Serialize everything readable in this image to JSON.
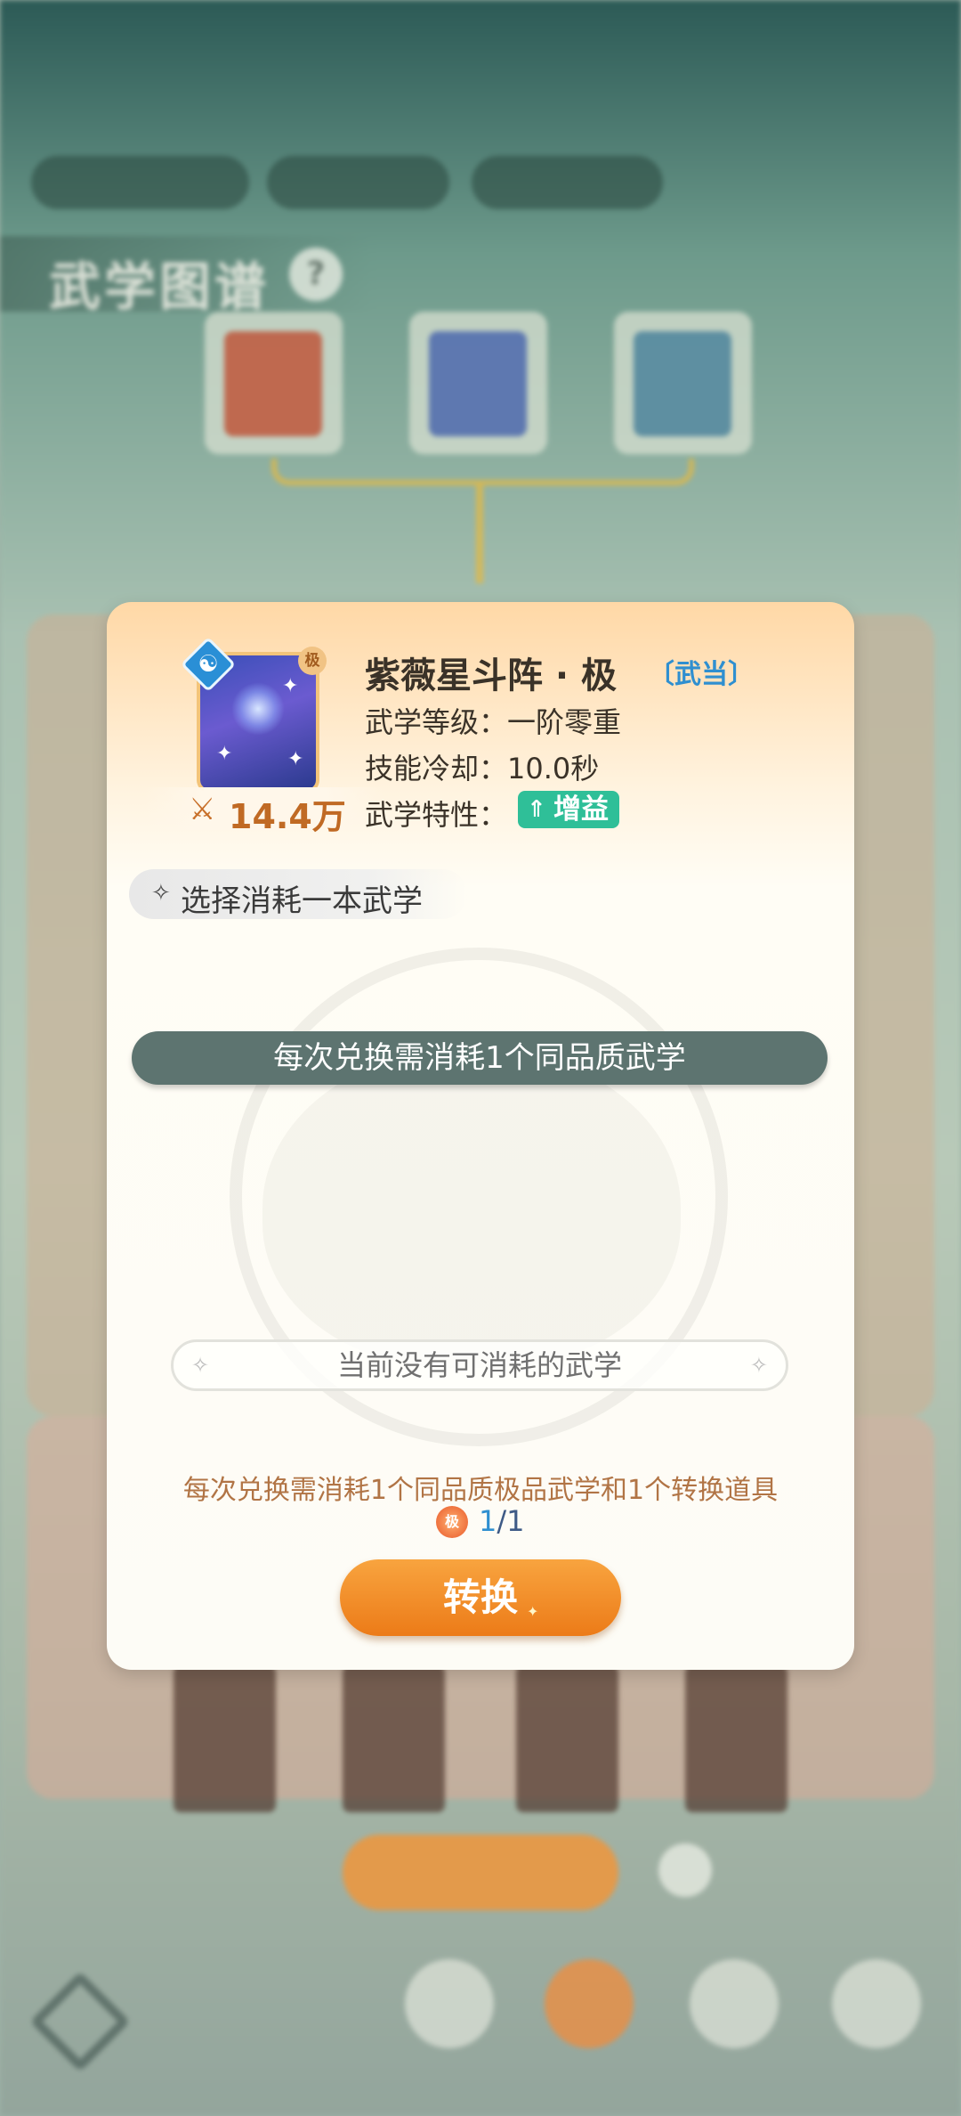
{
  "background": {
    "section_title": "武学图谱",
    "help_glyph": "?"
  },
  "dialog": {
    "skill": {
      "name": "紫薇星斗阵 · 极",
      "school": "〔武当〕",
      "grade_badge": "极",
      "power": "14.4万",
      "level_label": "武学等级：",
      "level_value": "一阶零重",
      "cooldown_label": "技能冷却：",
      "cooldown_value": "10.0秒",
      "trait_label": "武学特性：",
      "trait_value": "增益"
    },
    "select_prompt": "选择消耗一本武学",
    "notice": "每次兑换需消耗1个同品质武学",
    "empty_message": "当前没有可消耗的武学",
    "cost_description": "每次兑换需消耗1个同品质极品武学和1个转换道具",
    "item": {
      "icon_text": "极",
      "have": "1",
      "separator": "/",
      "need": "1"
    },
    "convert_label": "转换"
  },
  "colors": {
    "accent_orange": "#ec7b18",
    "notice_bar": "#5d7470",
    "buff_green": "#2fbf98",
    "school_blue": "#2f8fd0",
    "power_text": "#c06a24"
  }
}
